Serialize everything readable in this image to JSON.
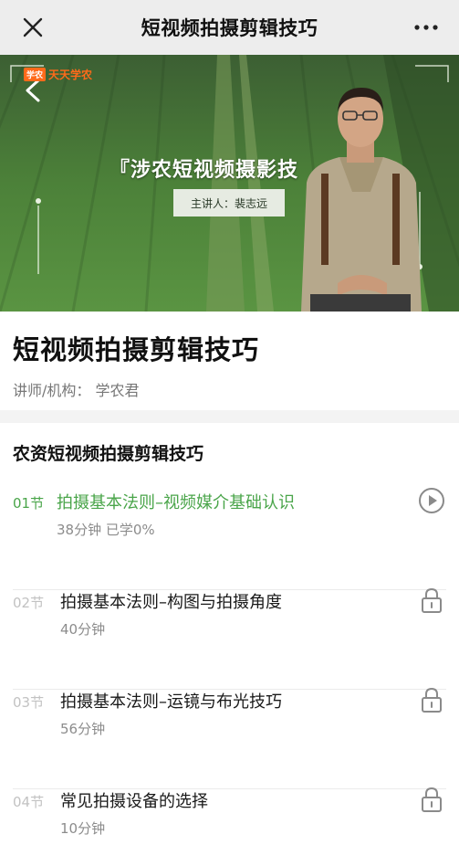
{
  "nav": {
    "title": "短视频拍摄剪辑技巧",
    "close_icon": "close-icon",
    "more_icon": "more-dots-icon"
  },
  "video": {
    "brand_mini": "学农",
    "brand_name": "天天学农",
    "banner_text": "『涉农短视频摄影技",
    "lecturer_label": "主讲人：裴志远"
  },
  "course": {
    "title": "短视频拍摄剪辑技巧",
    "teacher": "讲师/机构：  学农君"
  },
  "chapter": {
    "title": "农资短视频拍摄剪辑技巧",
    "lessons": [
      {
        "num": "01节",
        "name": "拍摄基本法则–视频媒介基础认识",
        "meta": "38分钟   已学0%",
        "state": "playing"
      },
      {
        "num": "02节",
        "name": "拍摄基本法则–构图与拍摄角度",
        "meta": "40分钟",
        "state": "locked"
      },
      {
        "num": "03节",
        "name": "拍摄基本法则–运镜与布光技巧",
        "meta": "56分钟",
        "state": "locked"
      },
      {
        "num": "04节",
        "name": "常见拍摄设备的选择",
        "meta": "10分钟",
        "state": "locked"
      }
    ]
  },
  "colors": {
    "accent_green": "#4aa54a",
    "brand_orange": "#ff6a1a",
    "nav_bg": "#ededed"
  }
}
